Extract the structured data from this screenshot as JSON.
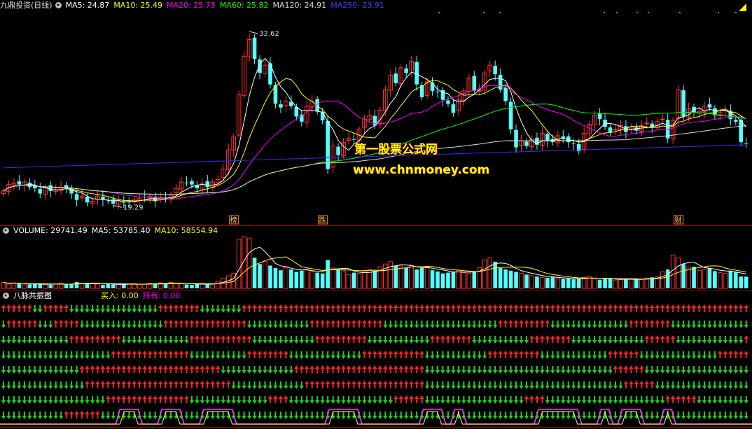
{
  "main_header": {
    "title": "九鼎投资(日线)",
    "ma5": "MA5: 24.87",
    "ma10": "MA10: 25.49",
    "ma20": "MA20: 25.73",
    "ma60": "MA60: 25.82",
    "ma120": "MA120: 24.91",
    "ma250": "MA250: 23.91"
  },
  "vol_header": {
    "label": "VOLUME: 29741.49",
    "ma5": "MA5: 53785.40",
    "ma10": "MA10: 58554.94"
  },
  "ind_header": {
    "title": "八脉共振图",
    "buy": "买入: 0.00",
    "hold": "持有: 0.00"
  },
  "watermark": {
    "line1": "第一股票公式网",
    "line2": "www.chnmoney.com"
  },
  "annotations": {
    "high": "32.62",
    "low": "19.29"
  },
  "tags": [
    {
      "text": "榜",
      "bar": 44
    },
    {
      "text": "跌",
      "bar": 61
    },
    {
      "text": "财",
      "bar": 129
    }
  ],
  "colors": {
    "up": "#ff3232",
    "down": "#54ffff",
    "ma5": "#ffffff",
    "ma10": "#ffff00",
    "ma20": "#ff00ff",
    "ma60": "#00ff00",
    "ma120": "#dddddd",
    "ma250": "#3030ff",
    "arrow_up": "#ff2020",
    "arrow_down": "#22cc22",
    "signal": "#ff33ff"
  },
  "chart_data": {
    "type": "candlestick",
    "price_range": [
      18.6,
      34.2
    ],
    "bars": 143,
    "closes": [
      20.3,
      20.8,
      20.9,
      20.8,
      21.0,
      20.6,
      20.5,
      20.1,
      20.6,
      20.3,
      20.4,
      20.6,
      20.5,
      20.1,
      19.6,
      19.9,
      19.4,
      19.5,
      19.9,
      19.6,
      19.5,
      19.3,
      19.5,
      19.4,
      19.5,
      19.6,
      19.7,
      19.8,
      19.9,
      19.5,
      19.8,
      19.7,
      20.0,
      20.5,
      21.0,
      20.9,
      20.8,
      20.5,
      20.9,
      20.6,
      21.0,
      21.2,
      22.0,
      23.5,
      24.5,
      27.8,
      30.8,
      32.1,
      30.6,
      29.5,
      30.1,
      28.6,
      27.1,
      26.8,
      27.3,
      26.9,
      26.1,
      25.7,
      26.9,
      27.3,
      26.5,
      25.8,
      22.0,
      23.8,
      23.1,
      24.1,
      24.4,
      24.3,
      25.1,
      25.9,
      26.2,
      25.4,
      26.6,
      28.2,
      29.3,
      28.7,
      29.9,
      29.5,
      30.4,
      28.6,
      27.6,
      28.8,
      28.1,
      28.0,
      27.4,
      27.1,
      26.4,
      27.4,
      28.1,
      29.1,
      28.1,
      28.2,
      29.5,
      30.1,
      29.4,
      28.2,
      27.3,
      25.1,
      23.7,
      24.2,
      23.8,
      24.3,
      23.9,
      24.8,
      24.2,
      24.1,
      24.6,
      24.4,
      24.1,
      24.0,
      23.4,
      24.8,
      25.5,
      26.2,
      25.9,
      25.3,
      24.9,
      25.1,
      25.4,
      24.9,
      25.3,
      25.0,
      25.4,
      25.6,
      25.3,
      25.7,
      25.9,
      24.4,
      25.8,
      28.2,
      26.1,
      26.7,
      26.4,
      26.5,
      26.9,
      26.8,
      26.2,
      26.4,
      26.6,
      25.9,
      25.7,
      24.1,
      24.0
    ],
    "volumes": [
      15000,
      11000,
      14000,
      12000,
      9000,
      10000,
      11000,
      12000,
      10000,
      9000,
      11000,
      13000,
      10000,
      11000,
      16000,
      12000,
      14000,
      13000,
      11000,
      9000,
      12000,
      10000,
      9000,
      10000,
      11000,
      12000,
      10000,
      11000,
      13000,
      12000,
      14000,
      12000,
      15000,
      13000,
      12000,
      10000,
      9000,
      11000,
      12000,
      10000,
      11000,
      18000,
      25000,
      32000,
      38000,
      125000,
      132000,
      128000,
      78000,
      62000,
      68000,
      58000,
      52000,
      46000,
      53000,
      48000,
      42000,
      45000,
      48000,
      42000,
      40000,
      38000,
      72000,
      52000,
      48000,
      45000,
      35000,
      40000,
      38000,
      42000,
      48000,
      45000,
      55000,
      62000,
      68000,
      58000,
      57000,
      52000,
      57000,
      48000,
      52000,
      55000,
      46000,
      43000,
      38000,
      40000,
      42000,
      46000,
      40000,
      38000,
      43000,
      53000,
      72000,
      78000,
      68000,
      52000,
      48000,
      45000,
      42000,
      38000,
      35000,
      32000,
      30000,
      28000,
      27000,
      29000,
      26000,
      24000,
      25000,
      23000,
      24000,
      28000,
      30000,
      25000,
      22000,
      24000,
      26000,
      21000,
      22000,
      24000,
      23000,
      25000,
      22000,
      26000,
      28000,
      30000,
      42000,
      48000,
      85000,
      78000,
      62000,
      54000,
      55000,
      46000,
      48000,
      52000,
      44000,
      40000,
      38000,
      45000,
      42000,
      30000,
      29741
    ]
  },
  "indicator": {
    "rows": [
      "UUUUUUDDUUUUUDDDDDDDDDDDDDDDDDUUUUUUUUDDDDDDDDUUUUUUUUUUUUUUUUUUUUUUUUUUUUUUUUUUUUUUUUUUUUUUUUUUUUUUUUUUUUUUUUUUUUUUUUUUUUUUUUUUUUUUUUUUUUUUUUUUUUUUUUUUUUUUUUUUUUUUUUUUUUUUUUUUUUUUUUUUUUUUUUUUUUUUUUUUUUUUUUUUUUUUUUUUUUUUUUUUUUUUUUUU",
      "DUUUUUUDDDUUUUUDDDDDDDDDDDDDDDDUUUUUUUUUUUUUUUUDDDDDDDDDDDDUUUUUUUUUUUUUUDDDDDDDDDDDDDDDDDDDDDDUUUUUUUUUUDDDDDDDDDDDDDDDUUUUUUUUDDDDDDDDDDDDDDDDDDDDUUUUUU",
      "DDDDDDDDDDDDDUUUUUUUUUUDDDDDDDDDDDDDUUUUUUUUUUUUDDDDDDDDDDDDUUUUUUUUUUDDDDDDDDDDDDUUUUUUUUDDDDDDDDDDDUUUUUUUUDDDDDDDDDDDDDDUUUUUUDDDDDDDDDDDDDUUUUUUDDDDDDDD",
      "DDDDDDDDDDDDDDDDDDDDDUUUUUUUUUUUUUUUDDDDDDDDDDDUUUUUUUUDDDDDDDDDDDDDDUUUUUUUUUUUUDDDDDDDDDDDDUUUUUUUUUUDDDDDDDDDDDDDUUUUUUDDDDDDDDDDDDDDDUUUUUUDDDDDDDDDDD",
      "DDDDDDDDDDDDDDDUUUUUUUUUUUUUUUUUUUUUUUUUUUDDDDDDDDDDDDDDUUUUUUUUUUUUUUUUUUUUUUUUUDDDDDDDDDDDDDDDDDDDDDDDDDDDDDDDDDDDDUUUUUUDDDDDDDDDDDDDDDDDDDDDDDDDDDDDDDDDD",
      "DDDDDDDDDDDDDDDDUUUUUUUUUUUUUUUUUUUUUUUUUUUUDDDDDDDDDDDDDDUUUUUUUUUUUUUUUUUUUUUUUDDDDDDDDDDDDDDDDDDDDDDDDDDDDDDDDDDDDDDUUUUUUDDDDDDDDDDDDDDDDDDDDDDDDDDDDDDD",
      "DDDDDDDDDDDDDDDDDDDDUUUUUUUUUUUUUUUUDDDDDDDDDDDDDDDUUUUDDDDDDDDDDDDDDDDDDDDUUUUUUDDDDDDDDDDDDDDDDDDDUUUUDDDDDDDDDDDDDDDDDDDDDDDUUUUUUDDDDDDDDDDDDDDDDDDDD",
      "DDDDDDDDDDDDUUUUUUUDDDDDDDDDDDDDDDDDDDDDDDDDDDDDDDDDDDDDDDDDDDDDDDDDDDDDDDDDDDDDDDDDDDDDDDDDDDDDDDDDDDDDDDDDDDDDDDDDDDDDDDDDDDDDDDDDDDDDDDDDDDDDDDDDDDDDD"
    ],
    "signal_windows": [
      [
        22,
        26
      ],
      [
        30,
        34
      ],
      [
        38,
        44
      ],
      [
        62,
        68
      ],
      [
        80,
        84
      ],
      [
        86,
        88
      ],
      [
        102,
        110
      ],
      [
        114,
        116
      ],
      [
        118,
        122
      ],
      [
        126,
        128
      ]
    ]
  }
}
